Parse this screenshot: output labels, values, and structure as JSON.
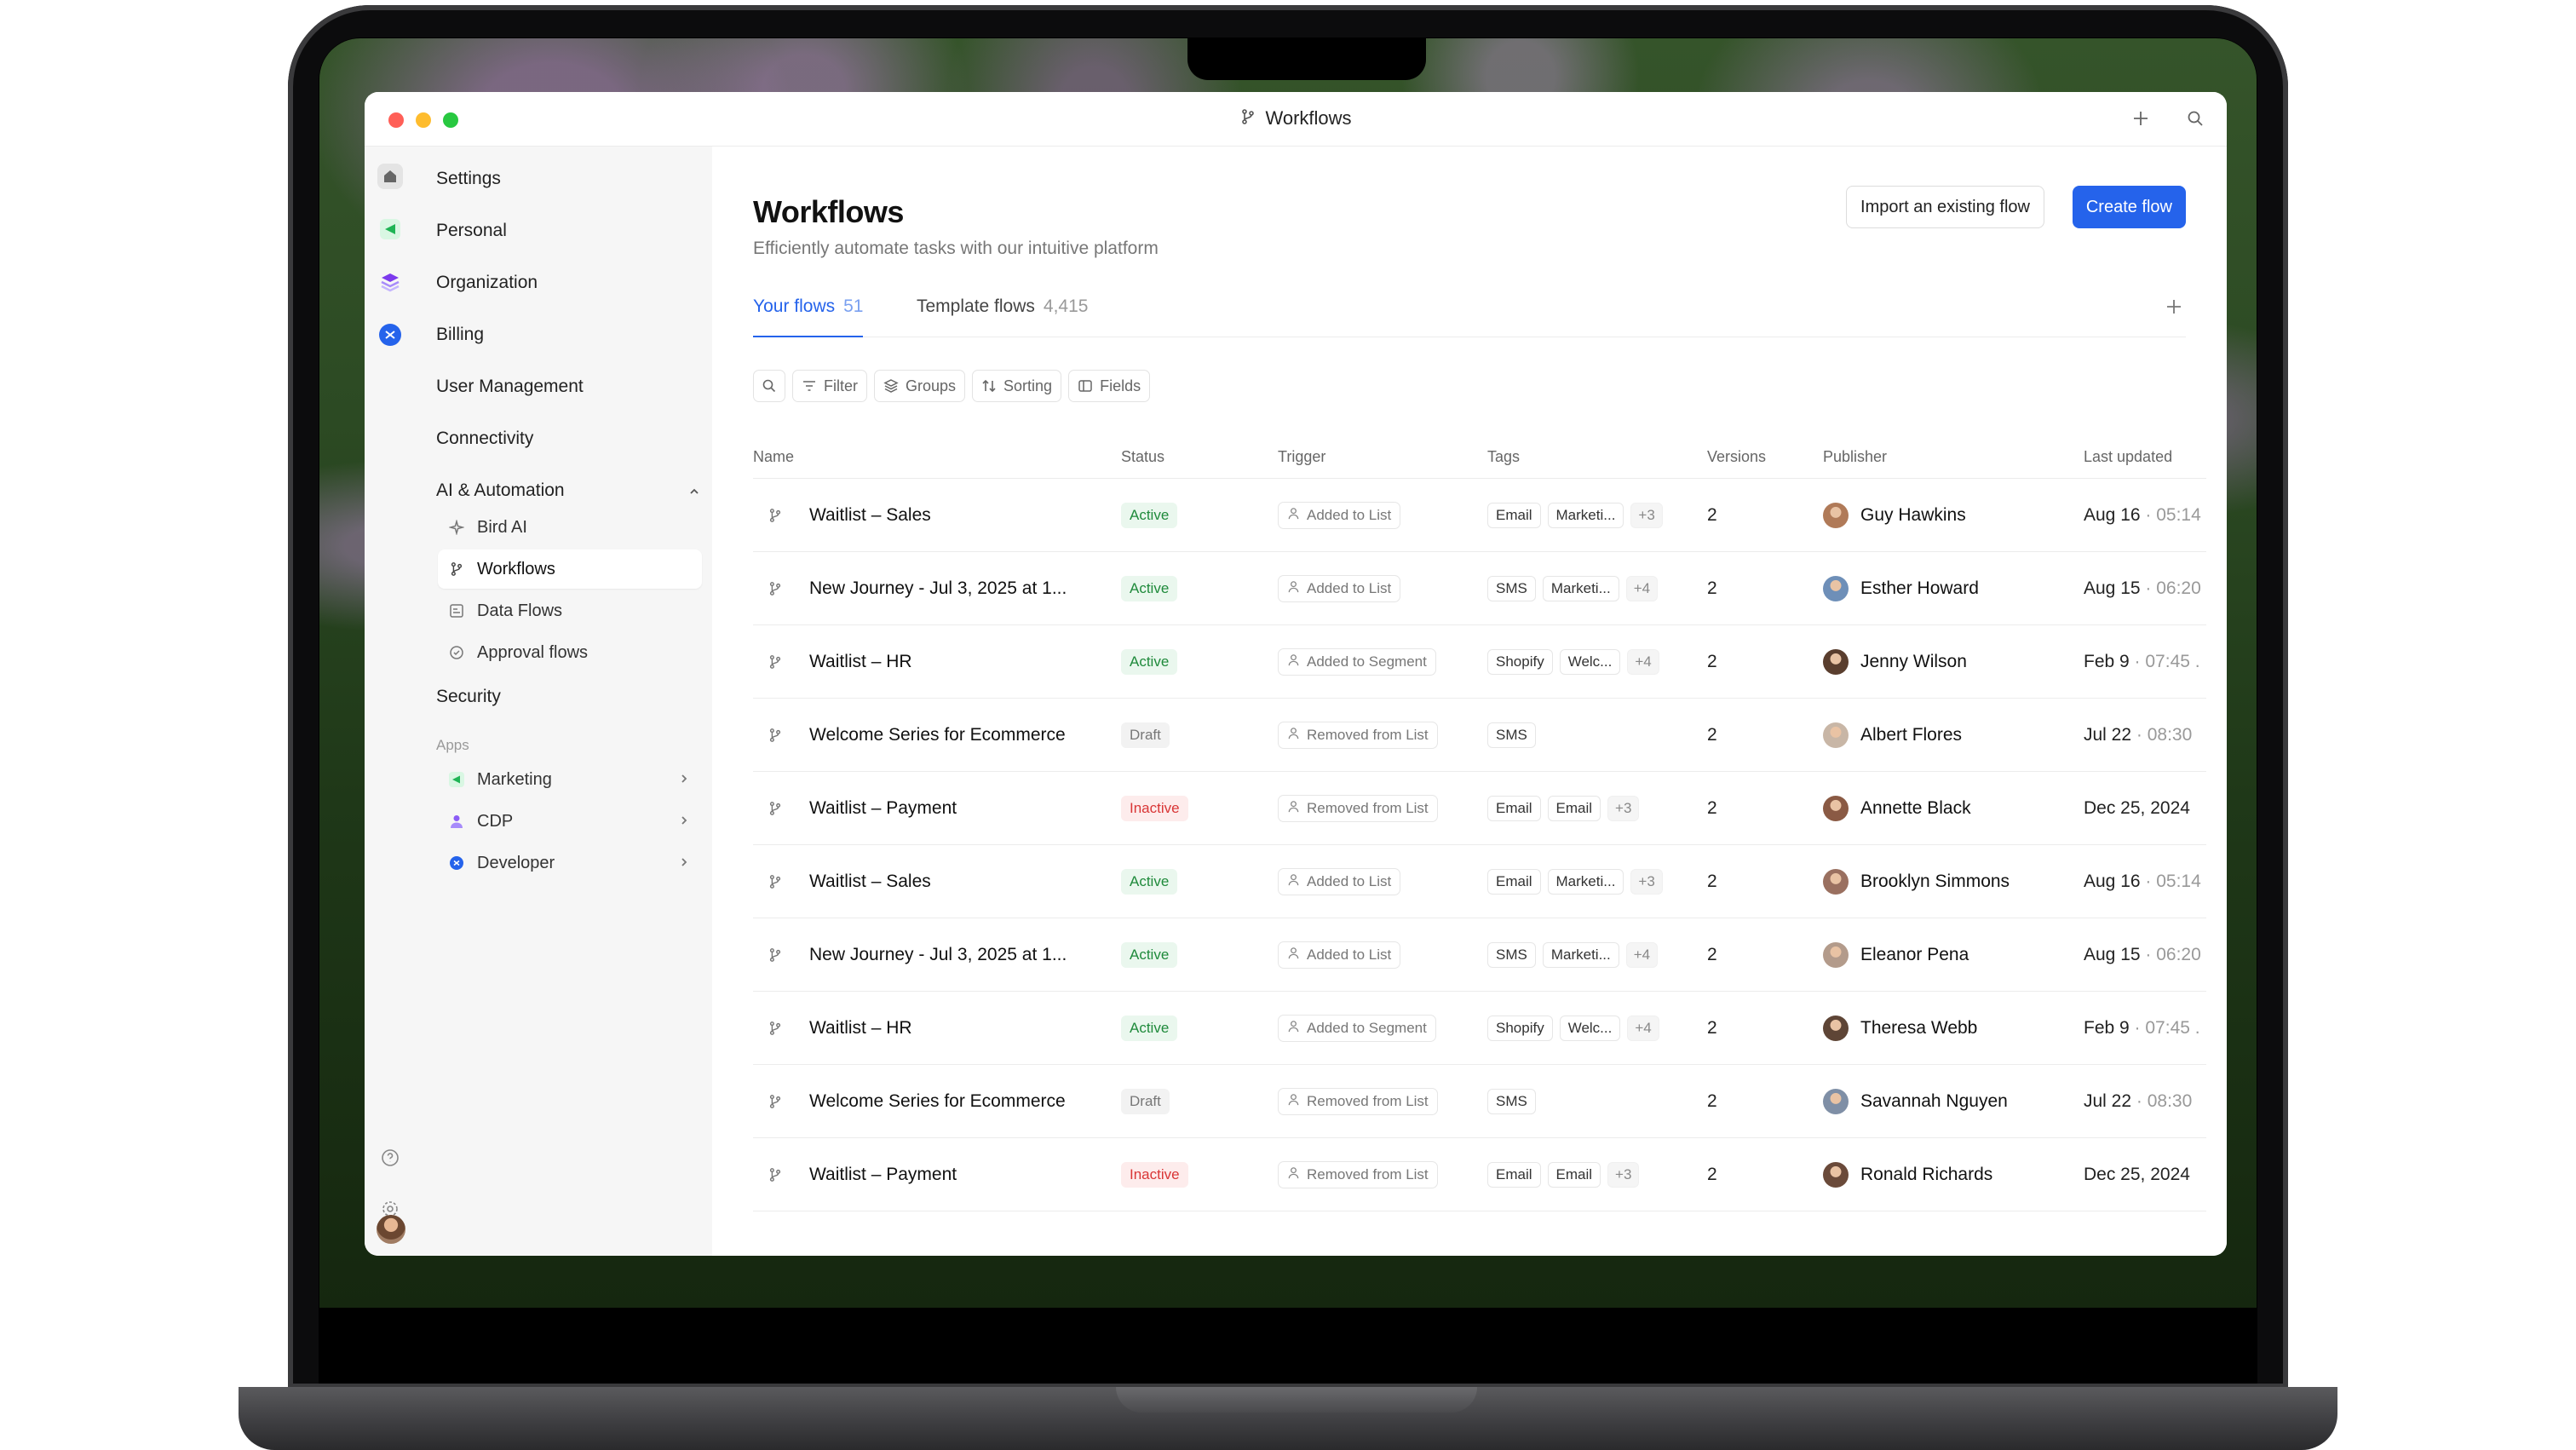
{
  "window": {
    "title": "Workflows"
  },
  "sidebar": {
    "items": [
      {
        "label": "Settings"
      },
      {
        "label": "Personal"
      },
      {
        "label": "Organization"
      },
      {
        "label": "Billing"
      },
      {
        "label": "User Management"
      },
      {
        "label": "Connectivity"
      },
      {
        "label": "AI & Automation"
      }
    ],
    "sub_items": [
      {
        "label": "Bird AI",
        "icon": "sparkle-icon"
      },
      {
        "label": "Workflows",
        "icon": "branch-icon",
        "active": true
      },
      {
        "label": "Data Flows",
        "icon": "data-flow-icon"
      },
      {
        "label": "Approval flows",
        "icon": "check-circle-icon"
      }
    ],
    "security": "Security",
    "apps_section": "Apps",
    "apps": [
      {
        "label": "Marketing",
        "color": "#22c55e"
      },
      {
        "label": "CDP",
        "color": "#8b5cf6"
      },
      {
        "label": "Developer",
        "color": "#2563eb"
      }
    ]
  },
  "main": {
    "title": "Workflows",
    "subtitle": "Efficiently automate tasks with our intuitive platform",
    "import_button": "Import an existing flow",
    "create_button": "Create flow",
    "tabs": [
      {
        "label": "Your flows",
        "count": "51"
      },
      {
        "label": "Template flows",
        "count": "4,415"
      }
    ],
    "toolbar": {
      "filter": "Filter",
      "groups": "Groups",
      "sorting": "Sorting",
      "fields": "Fields"
    },
    "columns": {
      "name": "Name",
      "status": "Status",
      "trigger": "Trigger",
      "tags": "Tags",
      "versions": "Versions",
      "publisher": "Publisher",
      "updated": "Last updated"
    },
    "rows": [
      {
        "name": "Waitlist – Sales",
        "status": "Active",
        "trigger": "Added to List",
        "tags": [
          "Email",
          "Marketi..."
        ],
        "more": "+3",
        "versions": "2",
        "publisher": "Guy Hawkins",
        "date": "Aug 16",
        "time": "· 05:14"
      },
      {
        "name": "New Journey - Jul 3, 2025 at 1...",
        "status": "Active",
        "trigger": "Added to List",
        "tags": [
          "SMS",
          "Marketi..."
        ],
        "more": "+4",
        "versions": "2",
        "publisher": "Esther Howard",
        "date": "Aug 15",
        "time": "· 06:20"
      },
      {
        "name": "Waitlist – HR",
        "status": "Active",
        "trigger": "Added to Segment",
        "tags": [
          "Shopify",
          "Welc..."
        ],
        "more": "+4",
        "versions": "2",
        "publisher": "Jenny Wilson",
        "date": "Feb 9",
        "time": "· 07:45 ."
      },
      {
        "name": "Welcome Series for Ecommerce",
        "status": "Draft",
        "trigger": "Removed from List",
        "tags": [
          "SMS"
        ],
        "more": "",
        "versions": "2",
        "publisher": "Albert Flores",
        "date": "Jul 22",
        "time": "· 08:30"
      },
      {
        "name": "Waitlist – Payment",
        "status": "Inactive",
        "trigger": "Removed from List",
        "tags": [
          "Email",
          "Email"
        ],
        "more": "+3",
        "versions": "2",
        "publisher": "Annette Black",
        "date": "Dec 25, 2024",
        "time": ""
      },
      {
        "name": "Waitlist – Sales",
        "status": "Active",
        "trigger": "Added to List",
        "tags": [
          "Email",
          "Marketi..."
        ],
        "more": "+3",
        "versions": "2",
        "publisher": "Brooklyn Simmons",
        "date": "Aug 16",
        "time": "· 05:14"
      },
      {
        "name": "New Journey - Jul 3, 2025 at 1...",
        "status": "Active",
        "trigger": "Added to List",
        "tags": [
          "SMS",
          "Marketi..."
        ],
        "more": "+4",
        "versions": "2",
        "publisher": "Eleanor Pena",
        "date": "Aug 15",
        "time": "· 06:20"
      },
      {
        "name": "Waitlist – HR",
        "status": "Active",
        "trigger": "Added to Segment",
        "tags": [
          "Shopify",
          "Welc..."
        ],
        "more": "+4",
        "versions": "2",
        "publisher": "Theresa Webb",
        "date": "Feb 9",
        "time": "· 07:45 ."
      },
      {
        "name": "Welcome Series for Ecommerce",
        "status": "Draft",
        "trigger": "Removed from List",
        "tags": [
          "SMS"
        ],
        "more": "",
        "versions": "2",
        "publisher": "Savannah Nguyen",
        "date": "Jul 22",
        "time": "· 08:30"
      },
      {
        "name": "Waitlist – Payment",
        "status": "Inactive",
        "trigger": "Removed from List",
        "tags": [
          "Email",
          "Email"
        ],
        "more": "+3",
        "versions": "2",
        "publisher": "Ronald Richards",
        "date": "Dec 25, 2024",
        "time": ""
      }
    ]
  },
  "colors": {
    "accent": "#2563eb",
    "active": "#1f8a3b",
    "inactive": "#d93636",
    "draft": "#777777"
  }
}
